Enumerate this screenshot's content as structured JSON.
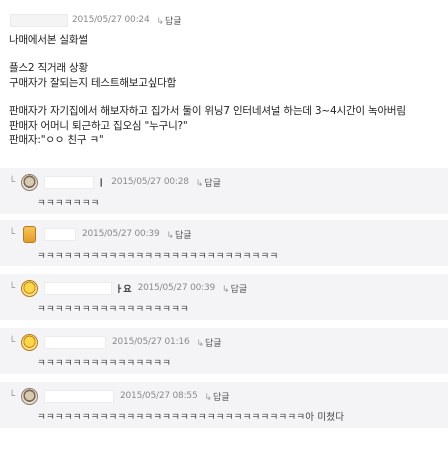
{
  "post": {
    "date": "2015/05/27 00:24",
    "reply_label": "답글",
    "body": [
      [
        "나매에서본 실화썰"
      ],
      [
        "플스2 직거래 상황",
        "구매자가 잘되는지 테스트해보고싶다함"
      ],
      [
        "판매자가 자기집에서 해보자하고 집가서 둘이 위닝7 인터네셔널 하는데 3~4시간이 녹아버림",
        "판매자 어머니 퇴근하고 집오심 \"누구니?\"",
        "판매자:\"ㅇㅇ 친구 ㅋ\""
      ]
    ]
  },
  "comments": [
    {
      "name_tail": "ㅣ",
      "date": "2015/05/27 00:28",
      "reply_label": "답글",
      "text": "ㅋㅋㅋㅋㅋㅋㅋ",
      "avatar": "gray-face"
    },
    {
      "name_tail": "",
      "date": "2015/05/27 00:39",
      "reply_label": "답글",
      "text": "ㅋㅋㅋㅋㅋㅋㅋㅋㅋㅋㅋㅋㅋㅋㅋㅋㅋㅋㅋㅋㅋㅋㅋㅋㅋㅋㅋ",
      "avatar": "yellow-figure"
    },
    {
      "name_tail": "ㅏ요",
      "date": "2015/05/27 00:39",
      "reply_label": "답글",
      "text": "ㅋㅋㅋㅋㅋㅋㅋㅋㅋㅋㅋㅋㅋㅋㅋㅋㅋ",
      "avatar": "yellow-face"
    },
    {
      "name_tail": "",
      "date": "2015/05/27 01:16",
      "reply_label": "답글",
      "text": "ㅋㅋㅋㅋㅋㅋㅋㅋㅋㅋㅋㅋㅋㅋㅋ",
      "avatar": "yellow-face"
    },
    {
      "name_tail": "",
      "date": "2015/05/27 08:55",
      "reply_label": "답글",
      "text": "ㅋㅋㅋㅋㅋㅋㅋㅋㅋㅋㅋㅋㅋㅋㅋㅋㅋㅋㅋㅋㅋㅋㅋㅋㅋㅋㅋㅋㅋㅋ아 미쳤다",
      "avatar": "gray-face"
    }
  ]
}
